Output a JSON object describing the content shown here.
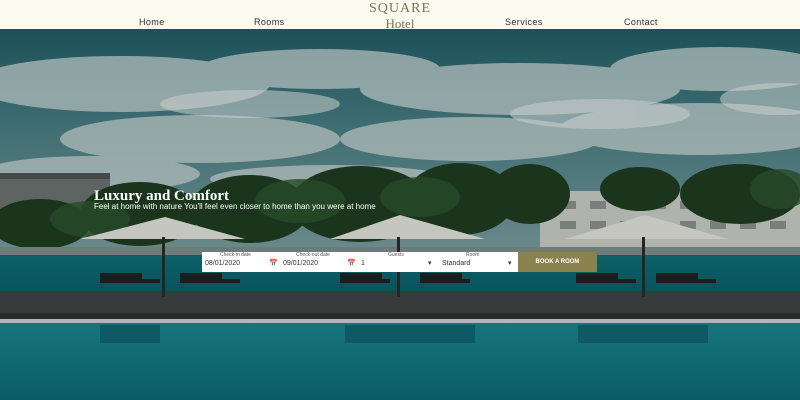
{
  "brand": {
    "name_top": "SQUARE",
    "name_bottom": "Hotel"
  },
  "nav": {
    "home": "Home",
    "rooms": "Rooms",
    "services": "Services",
    "contact": "Contact"
  },
  "hero": {
    "title": "Luxury and Comfort",
    "subtitle": "Feel at home with nature You'll feel even closer to home than you were at home"
  },
  "booking": {
    "checkin_label": "Check-in date",
    "checkin_value": "08/01/2020",
    "checkout_label": "Check-out date",
    "checkout_value": "09/01/2020",
    "guests_label": "Guests",
    "guests_value": "1",
    "room_label": "Room",
    "room_value": "Standard",
    "button_label": "BOOK A ROOM"
  },
  "colors": {
    "accent": "#8a8350",
    "header_bg": "#fbfbef",
    "brand_text": "#7a7550"
  },
  "icons": {
    "calendar": "calendar-icon",
    "dropdown": "chevron-down-icon"
  }
}
